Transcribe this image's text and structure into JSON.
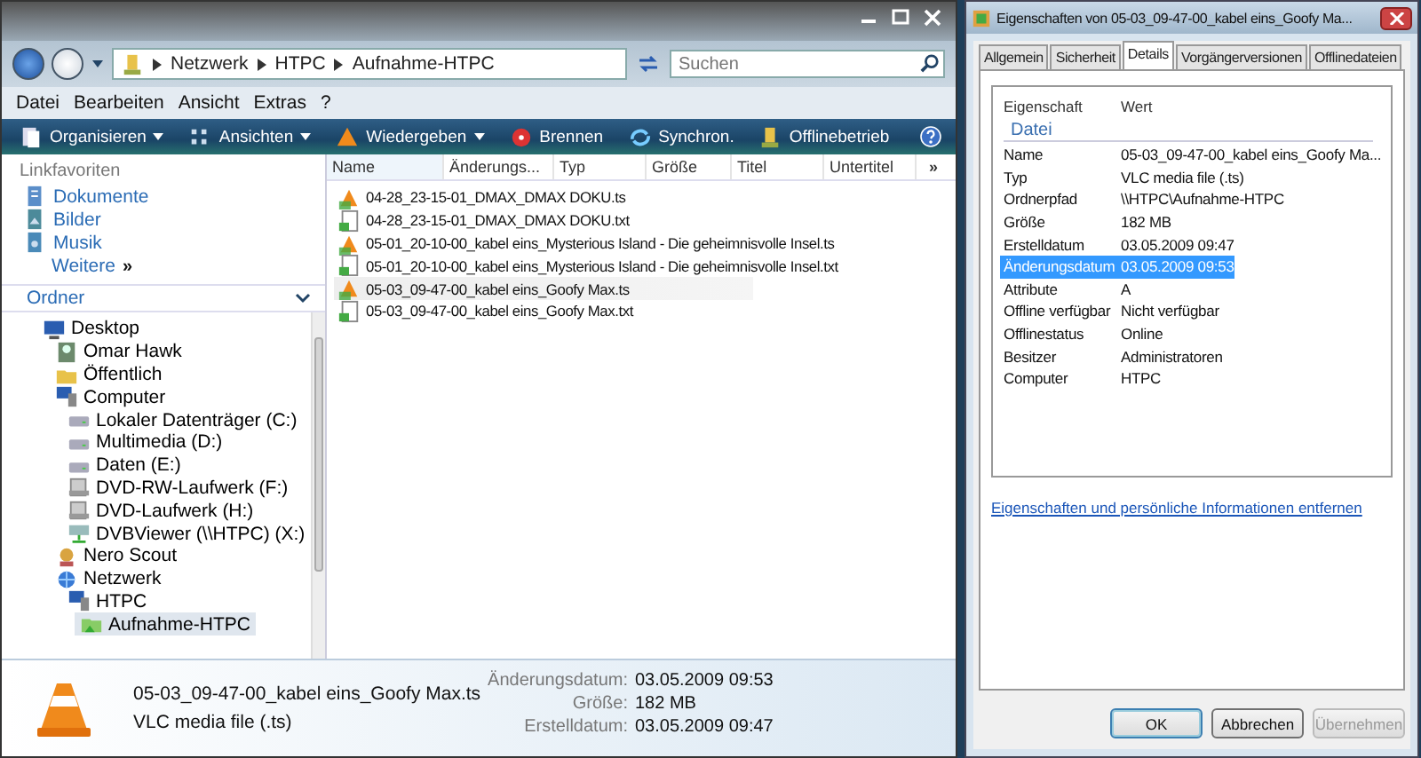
{
  "explorer": {
    "address": {
      "crumbs": [
        "Netzwerk",
        "HTPC",
        "Aufnahme-HTPC"
      ]
    },
    "search": {
      "placeholder": "Suchen"
    },
    "menu": [
      "Datei",
      "Bearbeiten",
      "Ansicht",
      "Extras",
      "?"
    ],
    "toolbar": [
      {
        "label": "Organisieren",
        "kind": "organize",
        "dropdown": true
      },
      {
        "label": "Ansichten",
        "kind": "views",
        "dropdown": true
      },
      {
        "label": "Wiedergeben",
        "kind": "play",
        "dropdown": true
      },
      {
        "label": "Brennen",
        "kind": "burn",
        "dropdown": false
      },
      {
        "label": "Synchron.",
        "kind": "sync",
        "dropdown": false
      },
      {
        "label": "Offlinebetrieb",
        "kind": "offline",
        "dropdown": false
      }
    ],
    "sidebar": {
      "favorites_title": "Linkfavoriten",
      "favorites": [
        {
          "label": "Dokumente",
          "kind": "documents"
        },
        {
          "label": "Bilder",
          "kind": "pictures"
        },
        {
          "label": "Musik",
          "kind": "music"
        }
      ],
      "more": "Weitere",
      "more_glyph": "»",
      "folders_title": "Ordner",
      "tree": [
        {
          "label": "Desktop",
          "kind": "desktop",
          "selected": false,
          "children": [
            {
              "label": "Omar Hawk",
              "kind": "user",
              "selected": false
            },
            {
              "label": "Öffentlich",
              "kind": "folder",
              "selected": false
            },
            {
              "label": "Computer",
              "kind": "computer",
              "selected": false,
              "children": [
                {
                  "label": "Lokaler Datenträger (C:)",
                  "kind": "drive",
                  "selected": false
                },
                {
                  "label": "Multimedia (D:)",
                  "kind": "drive",
                  "selected": false
                },
                {
                  "label": "Daten (E:)",
                  "kind": "drive",
                  "selected": false
                },
                {
                  "label": "DVD-RW-Laufwerk (F:)",
                  "kind": "optical",
                  "selected": false
                },
                {
                  "label": "DVD-Laufwerk (H:)",
                  "kind": "optical",
                  "selected": false
                },
                {
                  "label": "DVBViewer (\\\\HTPC) (X:)",
                  "kind": "netdrive",
                  "selected": false
                }
              ]
            },
            {
              "label": "Nero Scout",
              "kind": "scout",
              "selected": false
            },
            {
              "label": "Netzwerk",
              "kind": "network",
              "selected": false,
              "children": [
                {
                  "label": "HTPC",
                  "kind": "computer",
                  "selected": false,
                  "children": [
                    {
                      "label": "Aufnahme-HTPC",
                      "kind": "share",
                      "selected": true
                    }
                  ]
                }
              ]
            }
          ]
        }
      ]
    },
    "file_list": {
      "columns": [
        "Name",
        "Änderungs...",
        "Typ",
        "Größe",
        "Titel",
        "Untertitel"
      ],
      "overflow": "»",
      "files": [
        {
          "name": "04-28_23-15-01_DMAX_DMAX DOKU.ts",
          "kind": "video",
          "selected": false
        },
        {
          "name": "04-28_23-15-01_DMAX_DMAX DOKU.txt",
          "kind": "text",
          "selected": false
        },
        {
          "name": "05-01_20-10-00_kabel eins_Mysterious Island - Die geheimnisvolle Insel.ts",
          "kind": "video",
          "selected": false
        },
        {
          "name": "05-01_20-10-00_kabel eins_Mysterious Island - Die geheimnisvolle Insel.txt",
          "kind": "text",
          "selected": false
        },
        {
          "name": "05-03_09-47-00_kabel eins_Goofy  Max.ts",
          "kind": "video",
          "selected": true
        },
        {
          "name": "05-03_09-47-00_kabel eins_Goofy  Max.txt",
          "kind": "text",
          "selected": false
        }
      ]
    },
    "details_pane": {
      "name": "05-03_09-47-00_kabel eins_Goofy  Max.ts",
      "type": "VLC media file (.ts)",
      "fields": [
        {
          "label": "Änderungsdatum:",
          "value": "03.05.2009 09:53"
        },
        {
          "label": "Größe:",
          "value": "182 MB"
        },
        {
          "label": "Erstelldatum:",
          "value": "03.05.2009 09:47"
        }
      ]
    }
  },
  "properties": {
    "title": "Eigenschaften von 05-03_09-47-00_kabel eins_Goofy  Ma...",
    "tabs": [
      {
        "label": "Allgemein",
        "selected": false
      },
      {
        "label": "Sicherheit",
        "selected": false
      },
      {
        "label": "Details",
        "selected": true
      },
      {
        "label": "Vorgängerversionen",
        "selected": false
      },
      {
        "label": "Offlinedateien",
        "selected": false
      }
    ],
    "columns": [
      "Eigenschaft",
      "Wert"
    ],
    "group": "Datei",
    "rows": [
      {
        "property": "Name",
        "value": "05-03_09-47-00_kabel eins_Goofy  Ma...",
        "selected": false
      },
      {
        "property": "Typ",
        "value": "VLC media file (.ts)",
        "selected": false
      },
      {
        "property": "Ordnerpfad",
        "value": "\\\\HTPC\\Aufnahme-HTPC",
        "selected": false
      },
      {
        "property": "Größe",
        "value": "182 MB",
        "selected": false
      },
      {
        "property": "Erstelldatum",
        "value": "03.05.2009 09:47",
        "selected": false
      },
      {
        "property": "Änderungsdatum",
        "value": "03.05.2009 09:53",
        "selected": true
      },
      {
        "property": "Attribute",
        "value": "A",
        "selected": false
      },
      {
        "property": "Offline verfügbar",
        "value": "Nicht verfügbar",
        "selected": false
      },
      {
        "property": "Offlinestatus",
        "value": "Online",
        "selected": false
      },
      {
        "property": "Besitzer",
        "value": "Administratoren",
        "selected": false
      },
      {
        "property": "Computer",
        "value": "HTPC",
        "selected": false
      }
    ],
    "link": "Eigenschaften und persönliche Informationen entfernen",
    "buttons": [
      {
        "label": "OK",
        "disabled": false,
        "default": true
      },
      {
        "label": "Abbrechen",
        "disabled": false,
        "default": false
      },
      {
        "label": "Übernehmen",
        "disabled": true,
        "default": false
      }
    ]
  }
}
